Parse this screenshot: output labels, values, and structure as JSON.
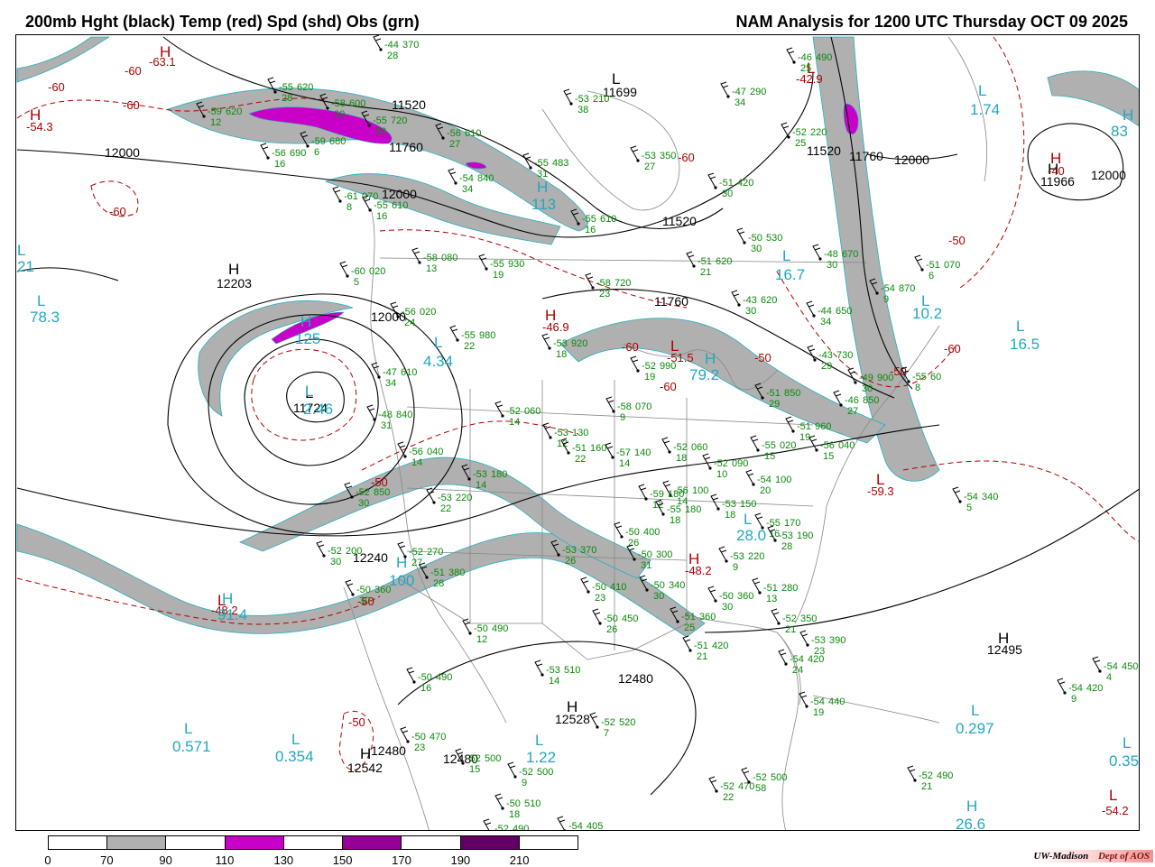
{
  "header": {
    "left_title": "200mb Hght (black) Temp (red) Spd (shd) Obs (grn)",
    "right_title": "NAM Analysis for 1200 UTC Thursday  OCT 09 2025"
  },
  "map": {
    "height_contour_labels": [
      "12000",
      "11520",
      "11760",
      "11520",
      "11760",
      "12000",
      "12000",
      "11520",
      "11760",
      "12000",
      "12240",
      "12480",
      "12480",
      "12480",
      "12000"
    ],
    "temp_labels": [
      "-60",
      "-60",
      "-60",
      "-60",
      "-60",
      "-50",
      "-60",
      "-60",
      "-50",
      "-50",
      "-50",
      "-50",
      "-60",
      "-50"
    ],
    "centers": [
      {
        "letter": "H",
        "value": "11966",
        "kind": "height"
      },
      {
        "letter": "L",
        "value": "11724",
        "kind": "height"
      },
      {
        "letter": "H",
        "value": "12203",
        "kind": "height"
      },
      {
        "letter": "H",
        "value": "12495",
        "kind": "height"
      },
      {
        "letter": "H",
        "value": "12528",
        "kind": "height"
      },
      {
        "letter": "L",
        "value": "11699",
        "kind": "height"
      },
      {
        "letter": "H",
        "value": "12542",
        "kind": "height"
      },
      {
        "letter": "H",
        "value": "-54.3",
        "kind": "temp"
      },
      {
        "letter": "H",
        "value": "-63.1",
        "kind": "temp"
      },
      {
        "letter": "H",
        "value": "-46.9",
        "kind": "temp"
      },
      {
        "letter": "L",
        "value": "-51.5",
        "kind": "temp"
      },
      {
        "letter": "L",
        "value": "-59.3",
        "kind": "temp"
      },
      {
        "letter": "H",
        "value": "-48.2",
        "kind": "temp"
      },
      {
        "letter": "L",
        "value": "-48.2",
        "kind": "temp"
      },
      {
        "letter": "L",
        "value": "-54.2",
        "kind": "temp"
      },
      {
        "letter": "L",
        "value": "-42.9",
        "kind": "temp"
      },
      {
        "letter": "H",
        "value": "-40",
        "kind": "temp"
      },
      {
        "letter": "L",
        "value": "1.74",
        "kind": "speed"
      },
      {
        "letter": "H",
        "value": "83",
        "kind": "speed"
      },
      {
        "letter": "L",
        "value": "21",
        "kind": "speed"
      },
      {
        "letter": "L",
        "value": "78.3",
        "kind": "speed"
      },
      {
        "letter": "H",
        "value": "113",
        "kind": "speed"
      },
      {
        "letter": "L",
        "value": "16.7",
        "kind": "speed"
      },
      {
        "letter": "L",
        "value": "16.5",
        "kind": "speed"
      },
      {
        "letter": "L",
        "value": "4.34",
        "kind": "speed"
      },
      {
        "letter": "H",
        "value": "79.2",
        "kind": "speed"
      },
      {
        "letter": "L",
        "value": "2.46",
        "kind": "speed"
      },
      {
        "letter": "H",
        "value": "125",
        "kind": "speed"
      },
      {
        "letter": "L",
        "value": "28.0",
        "kind": "speed"
      },
      {
        "letter": "H",
        "value": "91.4",
        "kind": "speed"
      },
      {
        "letter": "H",
        "value": "100",
        "kind": "speed"
      },
      {
        "letter": "L",
        "value": "0.571",
        "kind": "speed"
      },
      {
        "letter": "L",
        "value": "0.354",
        "kind": "speed"
      },
      {
        "letter": "L",
        "value": "1.22",
        "kind": "speed"
      },
      {
        "letter": "L",
        "value": "0.297",
        "kind": "speed"
      },
      {
        "letter": "H",
        "value": "26.6",
        "kind": "speed"
      },
      {
        "letter": "L",
        "value": "0.35",
        "kind": "speed"
      },
      {
        "letter": "L",
        "value": "10.2",
        "kind": "speed"
      }
    ],
    "observations": [
      {
        "temp": "-44",
        "hgt": "370",
        "spd": "28"
      },
      {
        "temp": "-55",
        "hgt": "620",
        "spd": "28"
      },
      {
        "temp": "-58",
        "hgt": "600",
        "spd": "30"
      },
      {
        "temp": "-59",
        "hgt": "620",
        "spd": "12"
      },
      {
        "temp": "-55",
        "hgt": "720",
        "spd": "30"
      },
      {
        "temp": "-56",
        "hgt": "610",
        "spd": "27"
      },
      {
        "temp": "-59",
        "hgt": "680",
        "spd": "6"
      },
      {
        "temp": "-56",
        "hgt": "690",
        "spd": "16"
      },
      {
        "temp": "-54",
        "hgt": "840",
        "spd": "34"
      },
      {
        "temp": "-61",
        "hgt": "070",
        "spd": "8"
      },
      {
        "temp": "-55",
        "hgt": "610",
        "spd": "16"
      },
      {
        "temp": "-58",
        "hgt": "080",
        "spd": "13"
      },
      {
        "temp": "-55",
        "hgt": "930",
        "spd": "19"
      },
      {
        "temp": "-60",
        "hgt": "020",
        "spd": "5"
      },
      {
        "temp": "-56",
        "hgt": "020",
        "spd": "24"
      },
      {
        "temp": "-58",
        "hgt": "720",
        "spd": "23"
      },
      {
        "temp": "-55",
        "hgt": "980",
        "spd": "22"
      },
      {
        "temp": "-47",
        "hgt": "610",
        "spd": "34"
      },
      {
        "temp": "-48",
        "hgt": "840",
        "spd": "31"
      },
      {
        "temp": "-52",
        "hgt": "060",
        "spd": "14"
      },
      {
        "temp": "-53",
        "hgt": "920",
        "spd": "18"
      },
      {
        "temp": "-52",
        "hgt": "990",
        "spd": "19"
      },
      {
        "temp": "-58",
        "hgt": "070",
        "spd": "9"
      },
      {
        "temp": "-53",
        "hgt": "130",
        "spd": "12"
      },
      {
        "temp": "-51",
        "hgt": "160",
        "spd": "22"
      },
      {
        "temp": "-56",
        "hgt": "040",
        "spd": "14"
      },
      {
        "temp": "-53",
        "hgt": "180",
        "spd": "14"
      },
      {
        "temp": "-52",
        "hgt": "850",
        "spd": "30"
      },
      {
        "temp": "-53",
        "hgt": "220",
        "spd": "22"
      },
      {
        "temp": "-52",
        "hgt": "200",
        "spd": "30"
      },
      {
        "temp": "-52",
        "hgt": "270",
        "spd": "27"
      },
      {
        "temp": "-51",
        "hgt": "380",
        "spd": "28"
      },
      {
        "temp": "-50",
        "hgt": "360",
        "spd": "30"
      },
      {
        "temp": "-53",
        "hgt": "370",
        "spd": "26"
      },
      {
        "temp": "-50",
        "hgt": "400",
        "spd": "26"
      },
      {
        "temp": "-50",
        "hgt": "300",
        "spd": "31"
      },
      {
        "temp": "-50",
        "hgt": "410",
        "spd": "23"
      },
      {
        "temp": "-50",
        "hgt": "340",
        "spd": "30"
      },
      {
        "temp": "-50",
        "hgt": "450",
        "spd": "26"
      },
      {
        "temp": "-50",
        "hgt": "490",
        "spd": "12"
      },
      {
        "temp": "-53",
        "hgt": "510",
        "spd": "14"
      },
      {
        "temp": "-50",
        "hgt": "490",
        "spd": "16"
      },
      {
        "temp": "-50",
        "hgt": "470",
        "spd": "23"
      },
      {
        "temp": "-52",
        "hgt": "500",
        "spd": "15"
      },
      {
        "temp": "-52",
        "hgt": "500",
        "spd": "9"
      },
      {
        "temp": "-50",
        "hgt": "510",
        "spd": "18"
      },
      {
        "temp": "-52",
        "hgt": "490",
        "spd": "8"
      },
      {
        "temp": "-52",
        "hgt": "520",
        "spd": "7"
      },
      {
        "temp": "-51",
        "hgt": "360",
        "spd": "25"
      },
      {
        "temp": "-51",
        "hgt": "420",
        "spd": "21"
      },
      {
        "temp": "-50",
        "hgt": "360",
        "spd": "30"
      },
      {
        "temp": "-51",
        "hgt": "280",
        "spd": "13"
      },
      {
        "temp": "-52",
        "hgt": "350",
        "spd": "21"
      },
      {
        "temp": "-53",
        "hgt": "390",
        "spd": "23"
      },
      {
        "temp": "-54",
        "hgt": "420",
        "spd": "24"
      },
      {
        "temp": "-54",
        "hgt": "440",
        "spd": "19"
      },
      {
        "temp": "-53",
        "hgt": "220",
        "spd": "9"
      },
      {
        "temp": "-55",
        "hgt": "170",
        "spd": "16"
      },
      {
        "temp": "-53",
        "hgt": "190",
        "spd": "28"
      },
      {
        "temp": "-53",
        "hgt": "150",
        "spd": "18"
      },
      {
        "temp": "-54",
        "hgt": "100",
        "spd": "20"
      },
      {
        "temp": "-52",
        "hgt": "090",
        "spd": "10"
      },
      {
        "temp": "-55",
        "hgt": "020",
        "spd": "15"
      },
      {
        "temp": "-52",
        "hgt": "060",
        "spd": "18"
      },
      {
        "temp": "-56",
        "hgt": "100",
        "spd": "14"
      },
      {
        "temp": "-57",
        "hgt": "140",
        "spd": "14"
      },
      {
        "temp": "-59",
        "hgt": "180",
        "spd": "12"
      },
      {
        "temp": "-55",
        "hgt": "180",
        "spd": "18"
      },
      {
        "temp": "-51",
        "hgt": "960",
        "spd": "19"
      },
      {
        "temp": "-56",
        "hgt": "040",
        "spd": "15"
      },
      {
        "temp": "-51",
        "hgt": "850",
        "spd": "29"
      },
      {
        "temp": "-46",
        "hgt": "850",
        "spd": "27"
      },
      {
        "temp": "-49",
        "hgt": "900",
        "spd": "30"
      },
      {
        "temp": "-43",
        "hgt": "730",
        "spd": "29"
      },
      {
        "temp": "-44",
        "hgt": "650",
        "spd": "34"
      },
      {
        "temp": "-48",
        "hgt": "670",
        "spd": "30"
      },
      {
        "temp": "-54",
        "hgt": "870",
        "spd": "9"
      },
      {
        "temp": "-51",
        "hgt": "070",
        "spd": "6"
      },
      {
        "temp": "-43",
        "hgt": "620",
        "spd": "30"
      },
      {
        "temp": "-50",
        "hgt": "530",
        "spd": "30"
      },
      {
        "temp": "-51",
        "hgt": "620",
        "spd": "21"
      },
      {
        "temp": "-51",
        "hgt": "420",
        "spd": "30"
      },
      {
        "temp": "-53",
        "hgt": "350",
        "spd": "27"
      },
      {
        "temp": "-47",
        "hgt": "290",
        "spd": "34"
      },
      {
        "temp": "-46",
        "hgt": "490",
        "spd": "25"
      },
      {
        "temp": "-52",
        "hgt": "220",
        "spd": "25"
      },
      {
        "temp": "-55",
        "hgt": "483",
        "spd": "31"
      },
      {
        "temp": "-53",
        "hgt": "210",
        "spd": "38"
      },
      {
        "temp": "-55",
        "hgt": "610",
        "spd": "16"
      },
      {
        "temp": "-54",
        "hgt": "340",
        "spd": "5"
      },
      {
        "temp": "-54",
        "hgt": "450",
        "spd": "4"
      },
      {
        "temp": "-54",
        "hgt": "420",
        "spd": "9"
      },
      {
        "temp": "-52",
        "hgt": "490",
        "spd": "21"
      },
      {
        "temp": "-52",
        "hgt": "470",
        "spd": "22"
      },
      {
        "temp": "-52",
        "hgt": "500",
        "spd": "58"
      },
      {
        "temp": "-54",
        "hgt": "405",
        "spd": "5"
      },
      {
        "temp": "-55",
        "hgt": "60",
        "spd": "8"
      }
    ]
  },
  "legend": {
    "colors": [
      "#ffffff",
      "#b0b0b0",
      "#ffffff",
      "#c800c8",
      "#ffffff",
      "#960096",
      "#ffffff",
      "#640064",
      "#ffffff"
    ],
    "ticks": [
      "0",
      "70",
      "90",
      "110",
      "130",
      "150",
      "170",
      "190",
      "210"
    ]
  },
  "colors": {
    "height": "#000000",
    "temp": "#b00000",
    "speed_label": "#20a8c0",
    "obs": "#0a8a0a",
    "jet_70_90": "#b0b0b0",
    "jet_110_130": "#c800c8",
    "border": "#888888"
  },
  "credit": {
    "org": "UW-Madison",
    "dept": "Dept of AOS"
  }
}
